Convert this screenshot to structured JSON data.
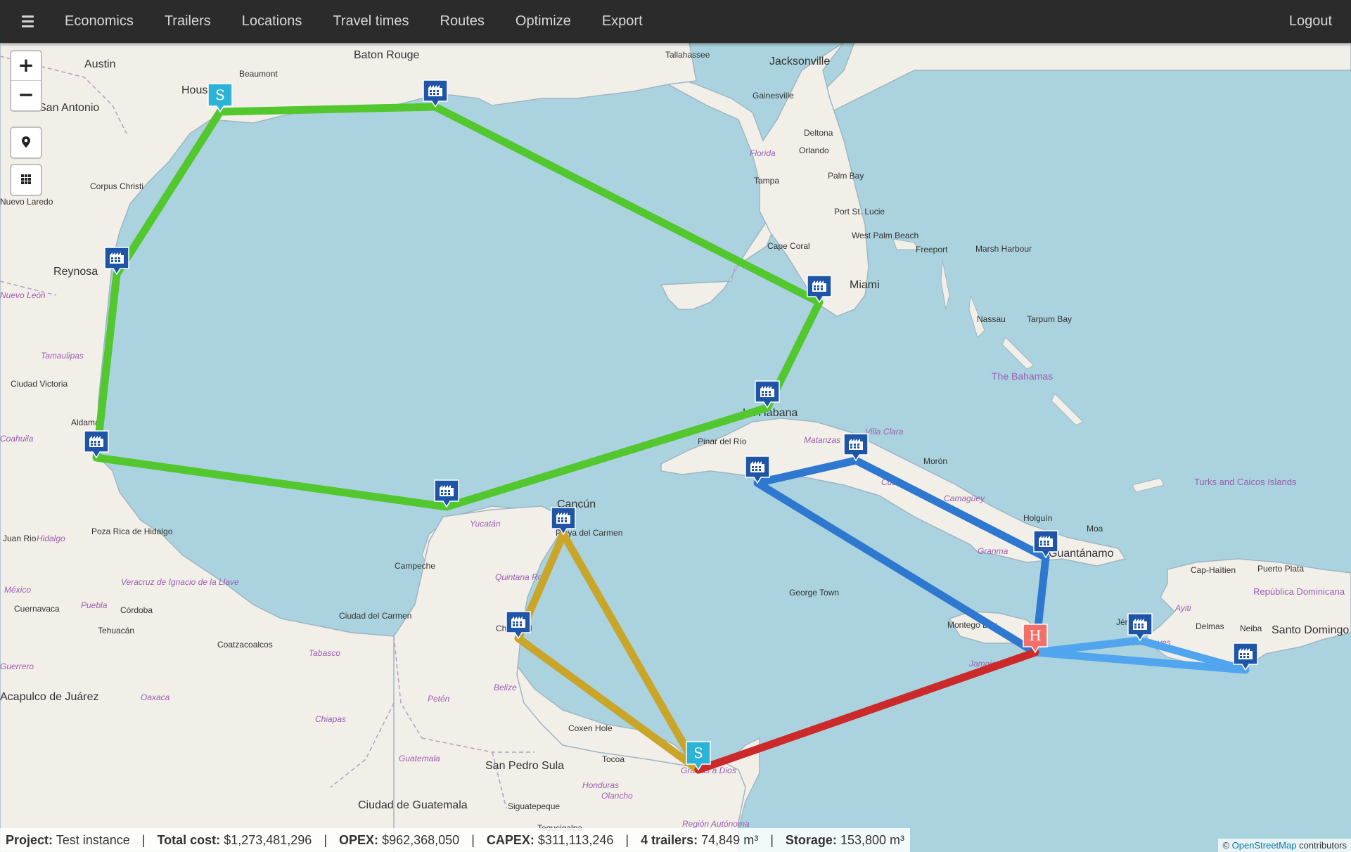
{
  "navbar": {
    "menu_items": [
      "Economics",
      "Trailers",
      "Locations",
      "Travel times",
      "Routes",
      "Optimize",
      "Export"
    ],
    "logout_label": "Logout"
  },
  "controls": {
    "zoom_in": "+",
    "zoom_out": "−"
  },
  "status": {
    "project_label": "Project:",
    "project_value": "Test instance",
    "total_cost_label": "Total cost:",
    "total_cost_value": "$1,273,481,296",
    "opex_label": "OPEX:",
    "opex_value": "$962,368,050",
    "capex_label": "CAPEX:",
    "capex_value": "$311,113,246",
    "trailers_label": "4 trailers:",
    "trailers_value": "74,849 m³",
    "storage_label": "Storage:",
    "storage_value": "153,800 m³"
  },
  "attribution": {
    "prefix": "©",
    "link": "OpenStreetMap",
    "suffix": "contributors"
  },
  "colors": {
    "route_green": "#52c72e",
    "route_blue": "#2f78d0",
    "route_light_blue": "#51a5ee",
    "route_gold": "#c9a52a",
    "route_red": "#cc2a2a",
    "marker_factory": "#1f55a6",
    "marker_source": "#2cb4d8",
    "marker_hub": "#f37068",
    "sea": "#aad3df",
    "land": "#f2efe9"
  },
  "markers": {
    "source_letter": "S",
    "hub_letter": "H"
  },
  "places": {
    "us": [
      "Austin",
      "Baton Rouge",
      "Beaumont",
      "Houston",
      "San Antonio",
      "Tallahassee",
      "Jacksonville",
      "Gainesville",
      "Deltona",
      "Orlando",
      "Florida",
      "Tampa",
      "Palm Bay",
      "Port St. Lucie",
      "Cape Coral",
      "West Palm Beach",
      "Miami",
      "Corpus Christi",
      "Nuevo Laredo"
    ],
    "mexico": [
      "Reynosa",
      "Nuevo León",
      "Tamaulipas",
      "Ciudad Victoria",
      "Aldama",
      "Coahuila",
      "Juan Rio",
      "Hidalgo",
      "Poza Rica de Hidalgo",
      "México",
      "Puebla",
      "Veracruz de Ignacio de la Llave",
      "Cuernavaca",
      "Córdoba",
      "Tehuacán",
      "Oaxaca",
      "Coatzacoalcos",
      "Tabasco",
      "Chiapas",
      "Campeche",
      "Ciudad del Carmen",
      "Yucatán",
      "Cancún",
      "Playa del Carmen",
      "Quintana Roo",
      "Chetumal",
      "Guerrero",
      "Acapulco de Juárez"
    ],
    "central": [
      "Belize",
      "Petén",
      "Guatemala",
      "Ciudad de Guatemala",
      "San Pedro Sula",
      "Honduras",
      "Olancho",
      "Siguatepeque",
      "Tegucigalpa",
      "Región Autónoma",
      "Coxen Hole",
      "Tocoa",
      "Gracias a Dios"
    ],
    "caribbean": [
      "Freeport",
      "Marsh Harbour",
      "Nassau",
      "Tarpum Bay",
      "The Bahamas",
      "La Habana",
      "Pinar del Río",
      "Matanzas",
      "Villa Clara",
      "Cuba",
      "Camagüey",
      "Morón",
      "Granma",
      "Holguín",
      "Moa",
      "Guantánamo",
      "George Town",
      "Montego Bay",
      "Jamaica",
      "Turks and Caicos Islands",
      "Cap-Haïtien",
      "Puerto Plata",
      "República Dominicana",
      "Ayiti",
      "Jérémie",
      "Les Cayes",
      "Delmas",
      "Neiba",
      "Santo Domingo"
    ]
  }
}
